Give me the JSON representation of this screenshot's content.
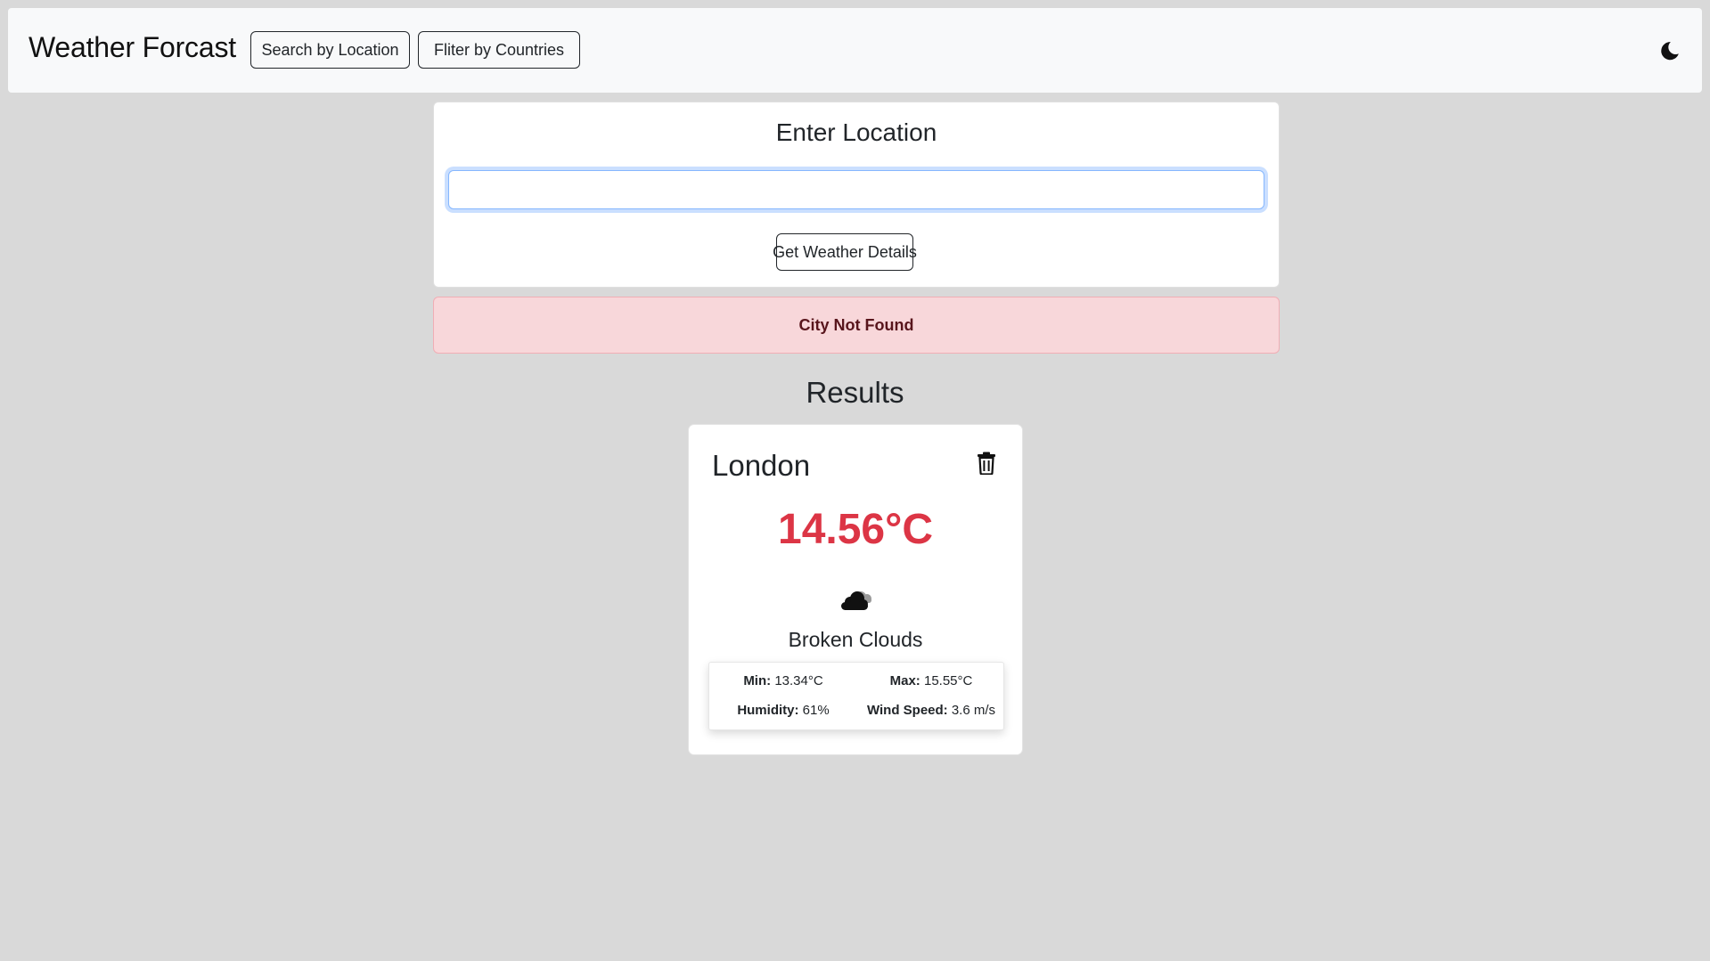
{
  "navbar": {
    "brand": "Weather Forcast",
    "search_button": "Search by Location",
    "filter_button": "Fliter by Countries",
    "theme_toggle_icon": "moon-icon"
  },
  "location_form": {
    "title": "Enter Location",
    "input_value": "",
    "submit_label": "Get Weather Details"
  },
  "alert": {
    "message": "City Not Found"
  },
  "results": {
    "heading": "Results",
    "cards": [
      {
        "city": "London",
        "temperature": "14.56°C",
        "icon": "broken-clouds-icon",
        "description": "Broken Clouds",
        "min_label": "Min:",
        "min_value": "13.34°C",
        "max_label": "Max:",
        "max_value": "15.55°C",
        "humidity_label": "Humidity:",
        "humidity_value": "61%",
        "wind_label": "Wind Speed:",
        "wind_value": "3.6 m/s",
        "delete_icon": "trash-icon"
      }
    ]
  },
  "colors": {
    "page_background": "#d9d9d9",
    "navbar_background": "#f8f9fa",
    "alert_background": "#f8d7da",
    "alert_text": "#58151c",
    "temperature": "#dc3545",
    "input_focus_border": "#86b7fe"
  }
}
